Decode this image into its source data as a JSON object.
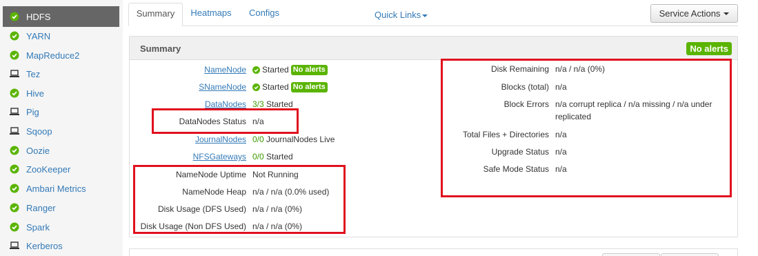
{
  "sidebar": {
    "services": [
      {
        "name": "HDFS",
        "icon": "check-circle-icon",
        "active": true
      },
      {
        "name": "YARN",
        "icon": "check-circle-icon"
      },
      {
        "name": "MapReduce2",
        "icon": "check-circle-icon"
      },
      {
        "name": "Tez",
        "icon": "laptop-icon"
      },
      {
        "name": "Hive",
        "icon": "check-circle-icon"
      },
      {
        "name": "Pig",
        "icon": "laptop-icon"
      },
      {
        "name": "Sqoop",
        "icon": "laptop-icon"
      },
      {
        "name": "Oozie",
        "icon": "check-circle-icon"
      },
      {
        "name": "ZooKeeper",
        "icon": "check-circle-icon"
      },
      {
        "name": "Ambari Metrics",
        "icon": "check-circle-icon"
      },
      {
        "name": "Ranger",
        "icon": "check-circle-icon"
      },
      {
        "name": "Spark",
        "icon": "check-circle-icon"
      },
      {
        "name": "Kerberos",
        "icon": "laptop-icon"
      }
    ]
  },
  "tabs": {
    "summary": "Summary",
    "heatmaps": "Heatmaps",
    "configs": "Configs",
    "quick_links": "Quick Links",
    "service_actions": "Service Actions"
  },
  "panel": {
    "title": "Summary",
    "alert_badge": "No alerts"
  },
  "left": {
    "namenode": {
      "label": "NameNode",
      "status": "Started",
      "badge": "No alerts"
    },
    "snamenode": {
      "label": "SNameNode",
      "status": "Started",
      "badge": "No alerts"
    },
    "datanodes": {
      "label": "DataNodes",
      "count": "3/3",
      "status": "Started"
    },
    "datanodes_status": {
      "label": "DataNodes Status",
      "value": "n/a"
    },
    "journalnodes": {
      "label": "JournalNodes",
      "count": "0/0",
      "status": "JournalNodes Live"
    },
    "nfsgateways": {
      "label": "NFSGateways",
      "count": "0/0",
      "status": "Started"
    },
    "namenode_uptime": {
      "label": "NameNode Uptime",
      "value": "Not Running"
    },
    "namenode_heap": {
      "label": "NameNode Heap",
      "value": "n/a / n/a (0.0% used)"
    },
    "disk_dfs": {
      "label": "Disk Usage (DFS Used)",
      "value": "n/a / n/a (0%)"
    },
    "disk_non_dfs": {
      "label": "Disk Usage (Non DFS Used)",
      "value": "n/a / n/a (0%)"
    }
  },
  "right": {
    "disk_remaining": {
      "label": "Disk Remaining",
      "value": "n/a / n/a (0%)"
    },
    "blocks_total": {
      "label": "Blocks (total)",
      "value": "n/a"
    },
    "block_errors": {
      "label": "Block Errors",
      "value_line1": "n/a corrupt replica / n/a missing / n/a under",
      "value_line2": "replicated"
    },
    "total_files": {
      "label": "Total Files + Directories",
      "value": "n/a"
    },
    "upgrade_status": {
      "label": "Upgrade Status",
      "value": "n/a"
    },
    "safe_mode": {
      "label": "Safe Mode Status",
      "value": "n/a"
    }
  },
  "colors": {
    "accent_link": "#337ab7",
    "ok_green": "#5ab400",
    "highlight_red": "#e0101e",
    "sidebar_active": "#666666"
  }
}
